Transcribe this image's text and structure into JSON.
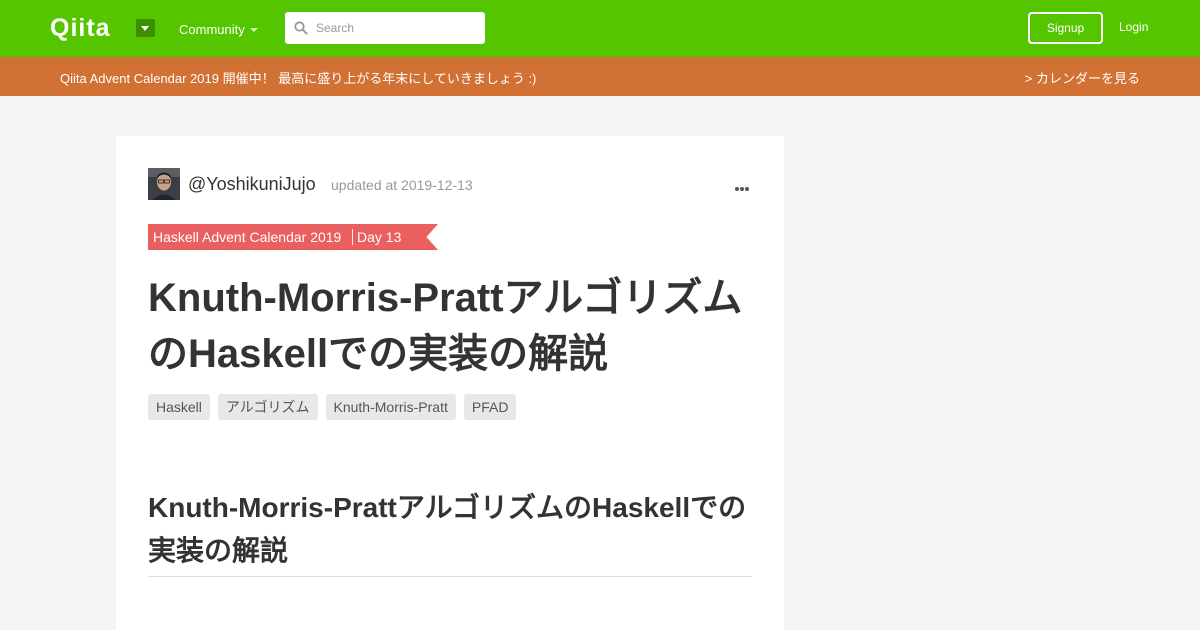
{
  "nav": {
    "logo": "Qiita",
    "community": "Community",
    "search_placeholder": "Search",
    "signup": "Signup",
    "login": "Login"
  },
  "announcement": {
    "text": "Qiita Advent Calendar 2019 開催中！ 最高に盛り上がる年末にしていきましょう :)",
    "link": "> カレンダーを見る"
  },
  "article": {
    "author": "@YoshikuniJujo",
    "updated": "updated at 2019-12-13",
    "calendar": "Haskell Advent Calendar 2019",
    "day": "Day 13",
    "title": "Knuth-Morris-PrattアルゴリズムのHaskellでの実装の解説",
    "tags": [
      "Haskell",
      "アルゴリズム",
      "Knuth-Morris-Pratt",
      "PFAD"
    ],
    "heading": "Knuth-Morris-PrattアルゴリズムのHaskellでの実装の解説"
  },
  "colors": {
    "brand": "#55c500",
    "announcement": "#d17134",
    "ribbon": "#ea5f5f"
  },
  "icons": {
    "search": "search-icon",
    "more": "more-icon",
    "caret": "caret-down-icon"
  }
}
